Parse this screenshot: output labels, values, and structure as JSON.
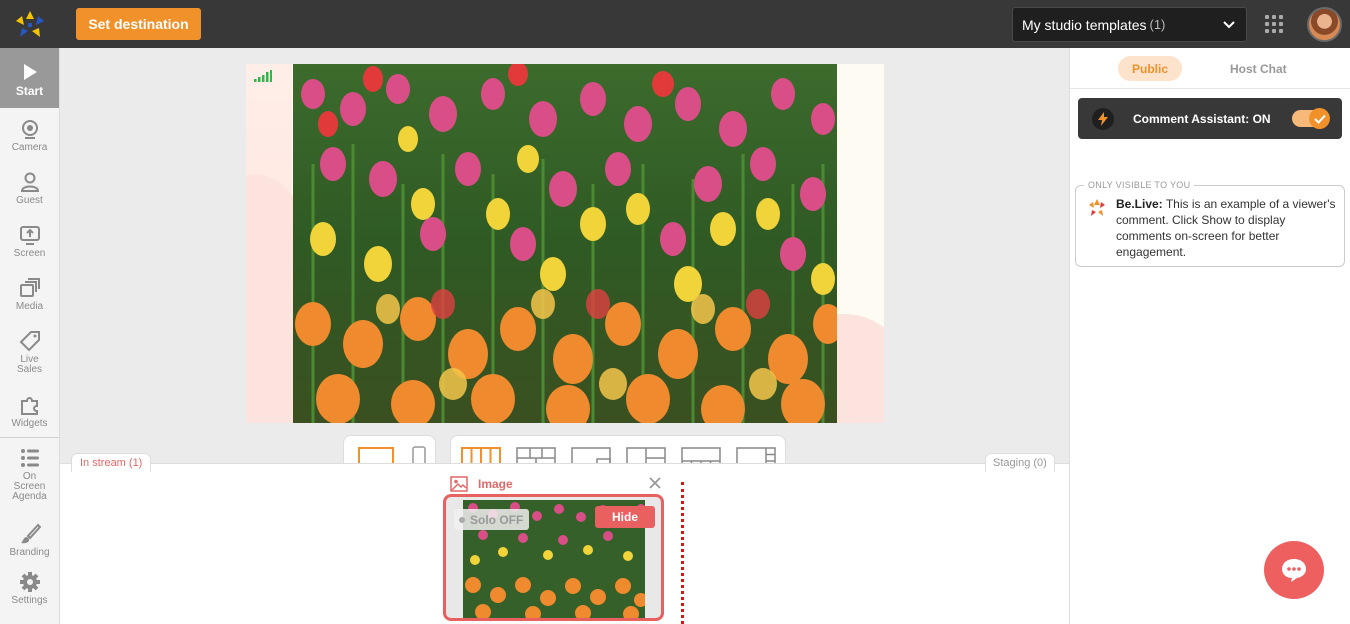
{
  "topbar": {
    "destination_label": "Set destination",
    "templates_label": "My studio templates",
    "templates_count": "(1)"
  },
  "sidebar": {
    "items": [
      {
        "label": "Start",
        "icon": "play-icon"
      },
      {
        "label": "Camera",
        "icon": "camera-icon"
      },
      {
        "label": "Guest",
        "icon": "person-icon"
      },
      {
        "label": "Screen",
        "icon": "screen-share-icon"
      },
      {
        "label": "Media",
        "icon": "media-icon"
      },
      {
        "label": "Live Sales",
        "icon": "tag-icon"
      },
      {
        "label": "Widgets",
        "icon": "puzzle-icon"
      },
      {
        "label": "On Screen Agenda",
        "icon": "list-icon"
      },
      {
        "label": "Branding",
        "icon": "brush-icon"
      },
      {
        "label": "Settings",
        "icon": "gear-icon"
      }
    ]
  },
  "stream": {
    "in_stream_label": "In stream (1)",
    "staging_label": "Staging (0)"
  },
  "media_card": {
    "title": "Image",
    "solo_label": "Solo OFF",
    "hide_label": "Hide"
  },
  "right_panel": {
    "tab_public": "Public",
    "tab_host": "Host Chat",
    "assistant_label": "Comment Assistant: ON",
    "comment_legend": "ONLY VISIBLE TO YOU",
    "comment_author": "Be.Live:",
    "comment_text": "This is an example of a viewer's comment. Click Show to display comments on-screen for better engagement."
  },
  "colors": {
    "accent": "#f0912a",
    "danger": "#e86060",
    "topbar": "#383838"
  }
}
